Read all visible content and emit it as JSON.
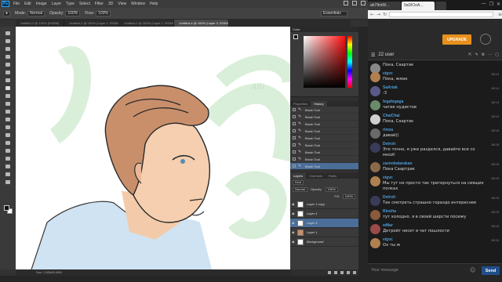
{
  "photoshop": {
    "logo": "Ps",
    "menu": [
      "File",
      "Edit",
      "Image",
      "Layer",
      "Type",
      "Select",
      "Filter",
      "3D",
      "View",
      "Window",
      "Help"
    ],
    "options": {
      "mode_label": "Mode:",
      "mode": "Normal",
      "opacity_label": "Opacity:",
      "opacity": "100%",
      "flow_label": "Flow:",
      "flow": "100%"
    },
    "workspace": "Essentials",
    "tabs": [
      "Untitled-1 @ 100% (RGB/8)",
      "Untitled-1 @ 100% (Layer 1, RGB/8)",
      "Untitled-2 @ 100% (Layer 1, RGB/8)",
      "Untitled-4 @ 100% (Layer 3, RGB/8)"
    ],
    "status": "Doc: 2,63M/9,49M",
    "canvas_signature": "Alli",
    "color_panel_title": "Color",
    "history_tabs": [
      "Properties",
      "History"
    ],
    "history": [
      "Brush Tool",
      "Brush Tool",
      "Brush Tool",
      "Brush Tool",
      "Brush Tool",
      "Brush Tool",
      "Brush Tool",
      "Brush Tool",
      "Brush Tool"
    ],
    "layers_tabs": [
      "Layers",
      "Channels",
      "Paths"
    ],
    "layers_kind": "Kind",
    "blend_mode": "Normal",
    "opacity_label": "Opacity:",
    "opacity": "100%",
    "fill_label": "Fill:",
    "fill": "100%",
    "layers": [
      "Layer 1 copy",
      "Layer 4",
      "Layer 3",
      "Layer 1",
      "Background"
    ]
  },
  "browser": {
    "tabs": [
      "ah79mW...",
      "9aDlOoA...",
      ""
    ],
    "window_controls": [
      "—",
      "❐",
      "✕"
    ]
  },
  "chat": {
    "upgrade_label": "UPGRADE",
    "users_count": "22 user",
    "input_placeholder": "Your message",
    "send_label": "Send",
    "messages": [
      {
        "user": "",
        "text": "Пока, Саартак",
        "time": "",
        "color": "#888"
      },
      {
        "user": "vigvc",
        "text": "Пока, жмак",
        "time": "18:14",
        "color": "#b08050"
      },
      {
        "user": "SaArtak",
        "text": ":3",
        "time": "18:14",
        "color": "#5a5a8a"
      },
      {
        "user": "fegafegaga",
        "text": "чатик нудистов",
        "time": "18:14",
        "color": "#6a8a6a"
      },
      {
        "user": "ChaiChai",
        "text": "Пока, Саартак",
        "time": "18:14",
        "color": "#cfcfcf"
      },
      {
        "user": "rimza",
        "text": "давай))",
        "time": "18:15",
        "color": "#6a6a6a"
      },
      {
        "user": "Detroit",
        "text": "Это точно, я уже разделся, давайте все со мной!",
        "time": "18:15",
        "color": "#3a3a5a"
      },
      {
        "user": "zaznobatarakan",
        "text": "Пока Саартрак",
        "time": "18:15",
        "color": "#8a6a4a"
      },
      {
        "user": "vigvc",
        "text": "Мы тут не просто так тригернуться на сиящих полках",
        "time": "18:15",
        "color": "#b08050"
      },
      {
        "user": "Detroit",
        "text": "Так смотреть страшно гораздо интереснее",
        "time": "18:15",
        "color": "#3a3a5a"
      },
      {
        "user": "Rinoha",
        "text": "тут холодно. я в своей шерсти посижу",
        "time": "18:15",
        "color": "#8a5a3a"
      },
      {
        "user": "wMar",
        "text": "Детройт несет в чат пошлости",
        "time": "18:15",
        "color": "#9a4a4a"
      },
      {
        "user": "vigvc",
        "text": "Ох ты ж",
        "time": "18:15",
        "color": "#b08050"
      }
    ]
  }
}
